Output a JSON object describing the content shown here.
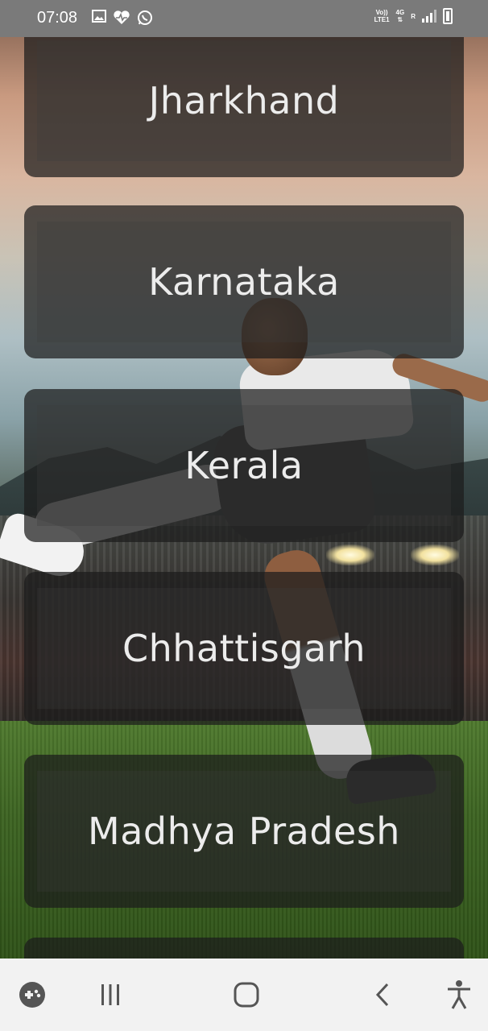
{
  "status_bar": {
    "time": "07:08",
    "left_icons": [
      "gallery-icon",
      "heart-icon",
      "whatsapp-icon"
    ],
    "network_volte": "Vo))",
    "network_lte": "LTE1",
    "network_4g": "4G",
    "network_r": "R"
  },
  "states": [
    {
      "label": "Jharkhand"
    },
    {
      "label": "Karnataka"
    },
    {
      "label": "Kerala"
    },
    {
      "label": "Chhattisgarh"
    },
    {
      "label": "Madhya Pradesh"
    }
  ],
  "nav_bar": {
    "buttons": [
      "game-launcher-icon",
      "recent-apps-icon",
      "home-icon",
      "back-icon",
      "accessibility-icon"
    ]
  },
  "colors": {
    "status_bar_bg": "#7a7a7a",
    "card_bg": "#1c1c1c",
    "card_text": "#ececec",
    "nav_bar_bg": "#f2f2f2",
    "nav_icon": "#555555"
  }
}
